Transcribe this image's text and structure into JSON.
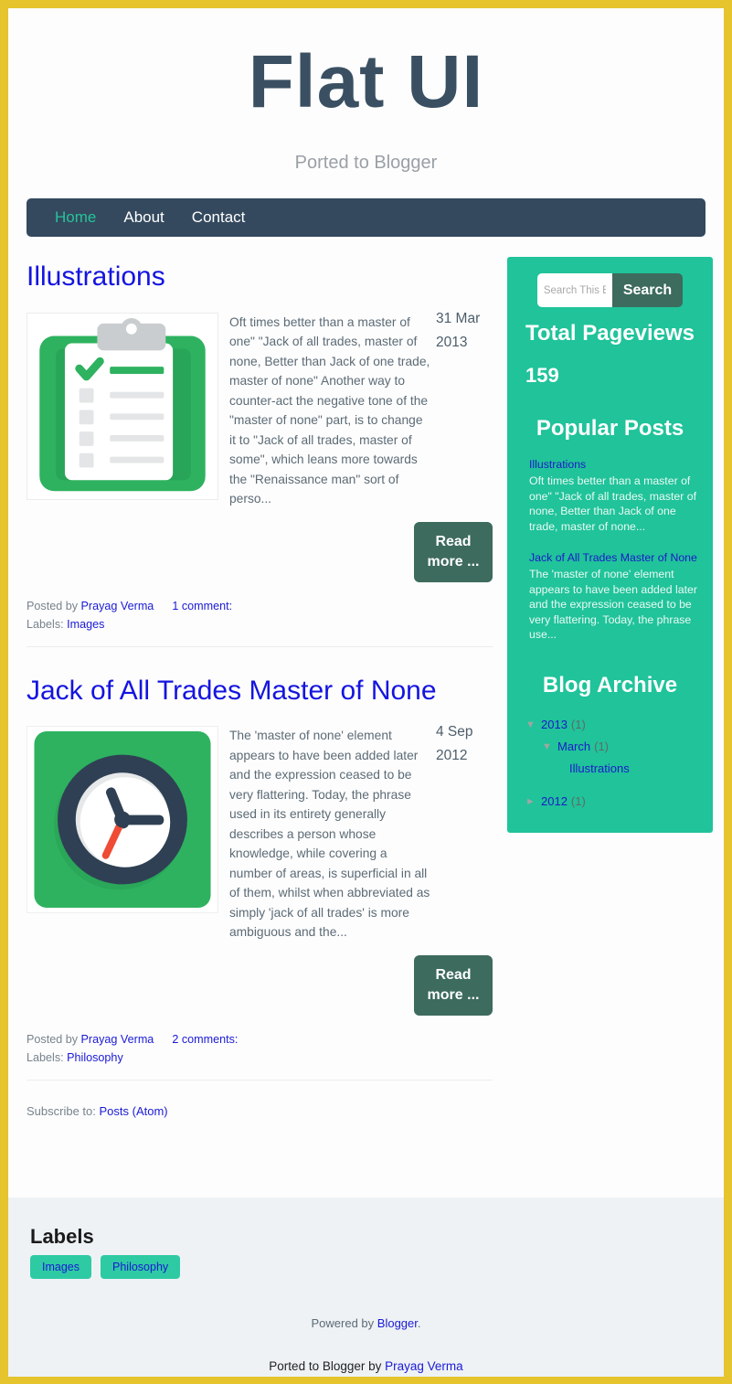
{
  "theme": {
    "page_border": "#e5c42d",
    "navbar_bg": "#34495e",
    "accent_teal": "#20c39a",
    "button_dark": "#3d6b5d",
    "link_blue": "#1a1ad6",
    "title_color": "#3a5062"
  },
  "header": {
    "title": "Flat UI",
    "subtitle": "Ported to Blogger"
  },
  "nav": {
    "items": [
      {
        "label": "Home",
        "active": true
      },
      {
        "label": "About",
        "active": false
      },
      {
        "label": "Contact",
        "active": false
      }
    ]
  },
  "posts": [
    {
      "title": "Illustrations",
      "date_day": "31 Mar",
      "date_year": "2013",
      "snippet": "Oft times better than a master of one\" \"Jack of all trades, master of none, Better than Jack of one trade, master of none\" Another way to counter-act the negative tone of the \"master of none\" part, is to change it to \"Jack of all trades, master of some\", which leans more towards the \"Renaissance man\" sort of perso...",
      "read_more": "Read more ...",
      "posted_by_prefix": "Posted by",
      "author": "Prayag Verma",
      "comments": "1 comment:",
      "labels_prefix": "Labels:",
      "label": "Images",
      "thumb": "clipboard-illustration"
    },
    {
      "title": "Jack of All Trades Master of None",
      "date_day": "4 Sep",
      "date_year": "2012",
      "snippet": "The 'master of none' element appears to have been added later and the expression ceased to be very flattering. Today, the phrase used in its entirety generally describes a person whose knowledge, while covering a number of areas, is superficial in all of them, whilst when abbreviated as simply 'jack of all trades' is more ambiguous and the...",
      "read_more": "Read more ...",
      "posted_by_prefix": "Posted by",
      "author": "Prayag Verma",
      "comments": "2 comments:",
      "labels_prefix": "Labels:",
      "label": "Philosophy",
      "thumb": "clock-illustration"
    }
  ],
  "subscribe": {
    "prefix": "Subscribe to:",
    "link": "Posts (Atom)"
  },
  "sidebar": {
    "search": {
      "placeholder": "Search This Blog",
      "value": "",
      "button_label": "Search"
    },
    "pageviews": {
      "heading": "Total Pageviews",
      "count": "159"
    },
    "popular": {
      "heading": "Popular Posts",
      "items": [
        {
          "title": "Illustrations",
          "snippet": "Oft times better than a master of one\" \"Jack of all trades, master of none, Better than Jack of one trade, master of none..."
        },
        {
          "title": "Jack of All Trades Master of None",
          "snippet": "The 'master of none' element appears to have been added later and the expression ceased to be very flattering. Today, the phrase use..."
        }
      ]
    },
    "archive": {
      "heading": "Blog Archive",
      "entries": [
        {
          "toggle": "▼",
          "label": "2013",
          "count": "(1)",
          "level": 1
        },
        {
          "toggle": "▼",
          "label": "March",
          "count": "(1)",
          "level": 2
        },
        {
          "toggle": "",
          "label": "Illustrations",
          "count": "",
          "level": 3
        },
        {
          "toggle": "►",
          "label": "2012",
          "count": "(1)",
          "level": 1
        }
      ]
    }
  },
  "footer": {
    "labels_heading": "Labels",
    "label_pills": [
      "Images",
      "Philosophy"
    ],
    "powered_prefix": "Powered by",
    "powered_link": "Blogger",
    "powered_suffix": ".",
    "attrib_prefix": "Ported to Blogger by",
    "attrib_link": "Prayag Verma"
  }
}
